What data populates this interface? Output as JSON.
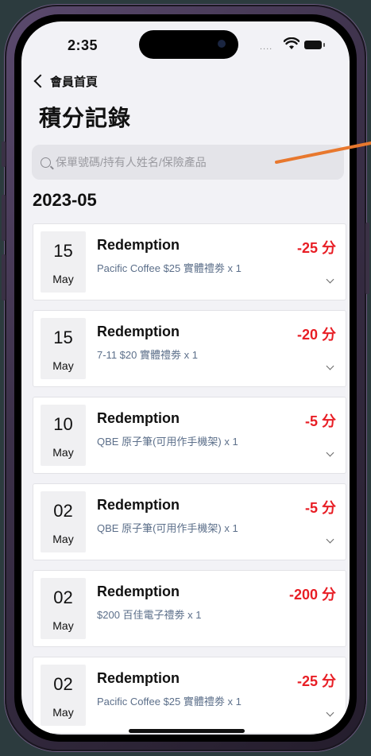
{
  "status_bar": {
    "time": "2:35",
    "signal": "...."
  },
  "nav": {
    "back_label": "會員首頁"
  },
  "page": {
    "title": "積分記錄"
  },
  "search": {
    "placeholder": "保單號碼/持有人姓名/保險產品",
    "value": ""
  },
  "section": {
    "month": "2023-05"
  },
  "records": [
    {
      "day": "15",
      "month": "May",
      "type": "Redemption",
      "description": "Pacific Coffee $25 實體禮劵 x 1",
      "points": "-25 分"
    },
    {
      "day": "15",
      "month": "May",
      "type": "Redemption",
      "description": "7-11 $20 實體禮劵 x 1",
      "points": "-20 分"
    },
    {
      "day": "10",
      "month": "May",
      "type": "Redemption",
      "description": "QBE 原子筆(可用作手機架) x 1",
      "points": "-5 分"
    },
    {
      "day": "02",
      "month": "May",
      "type": "Redemption",
      "description": "QBE 原子筆(可用作手機架) x 1",
      "points": "-5 分"
    },
    {
      "day": "02",
      "month": "May",
      "type": "Redemption",
      "description": "$200 百佳電子禮劵 x 1",
      "points": "-200 分"
    },
    {
      "day": "02",
      "month": "May",
      "type": "Redemption",
      "description": "Pacific Coffee $25 實體禮劵 x 1",
      "points": "-25 分"
    }
  ],
  "colors": {
    "points": "#e81e25",
    "description": "#5c6f8a",
    "annotation_arrow": "#e8782e"
  },
  "icons": [
    "back-chevron-icon",
    "search-icon",
    "chevron-down-icon",
    "wifi-icon",
    "battery-icon"
  ]
}
